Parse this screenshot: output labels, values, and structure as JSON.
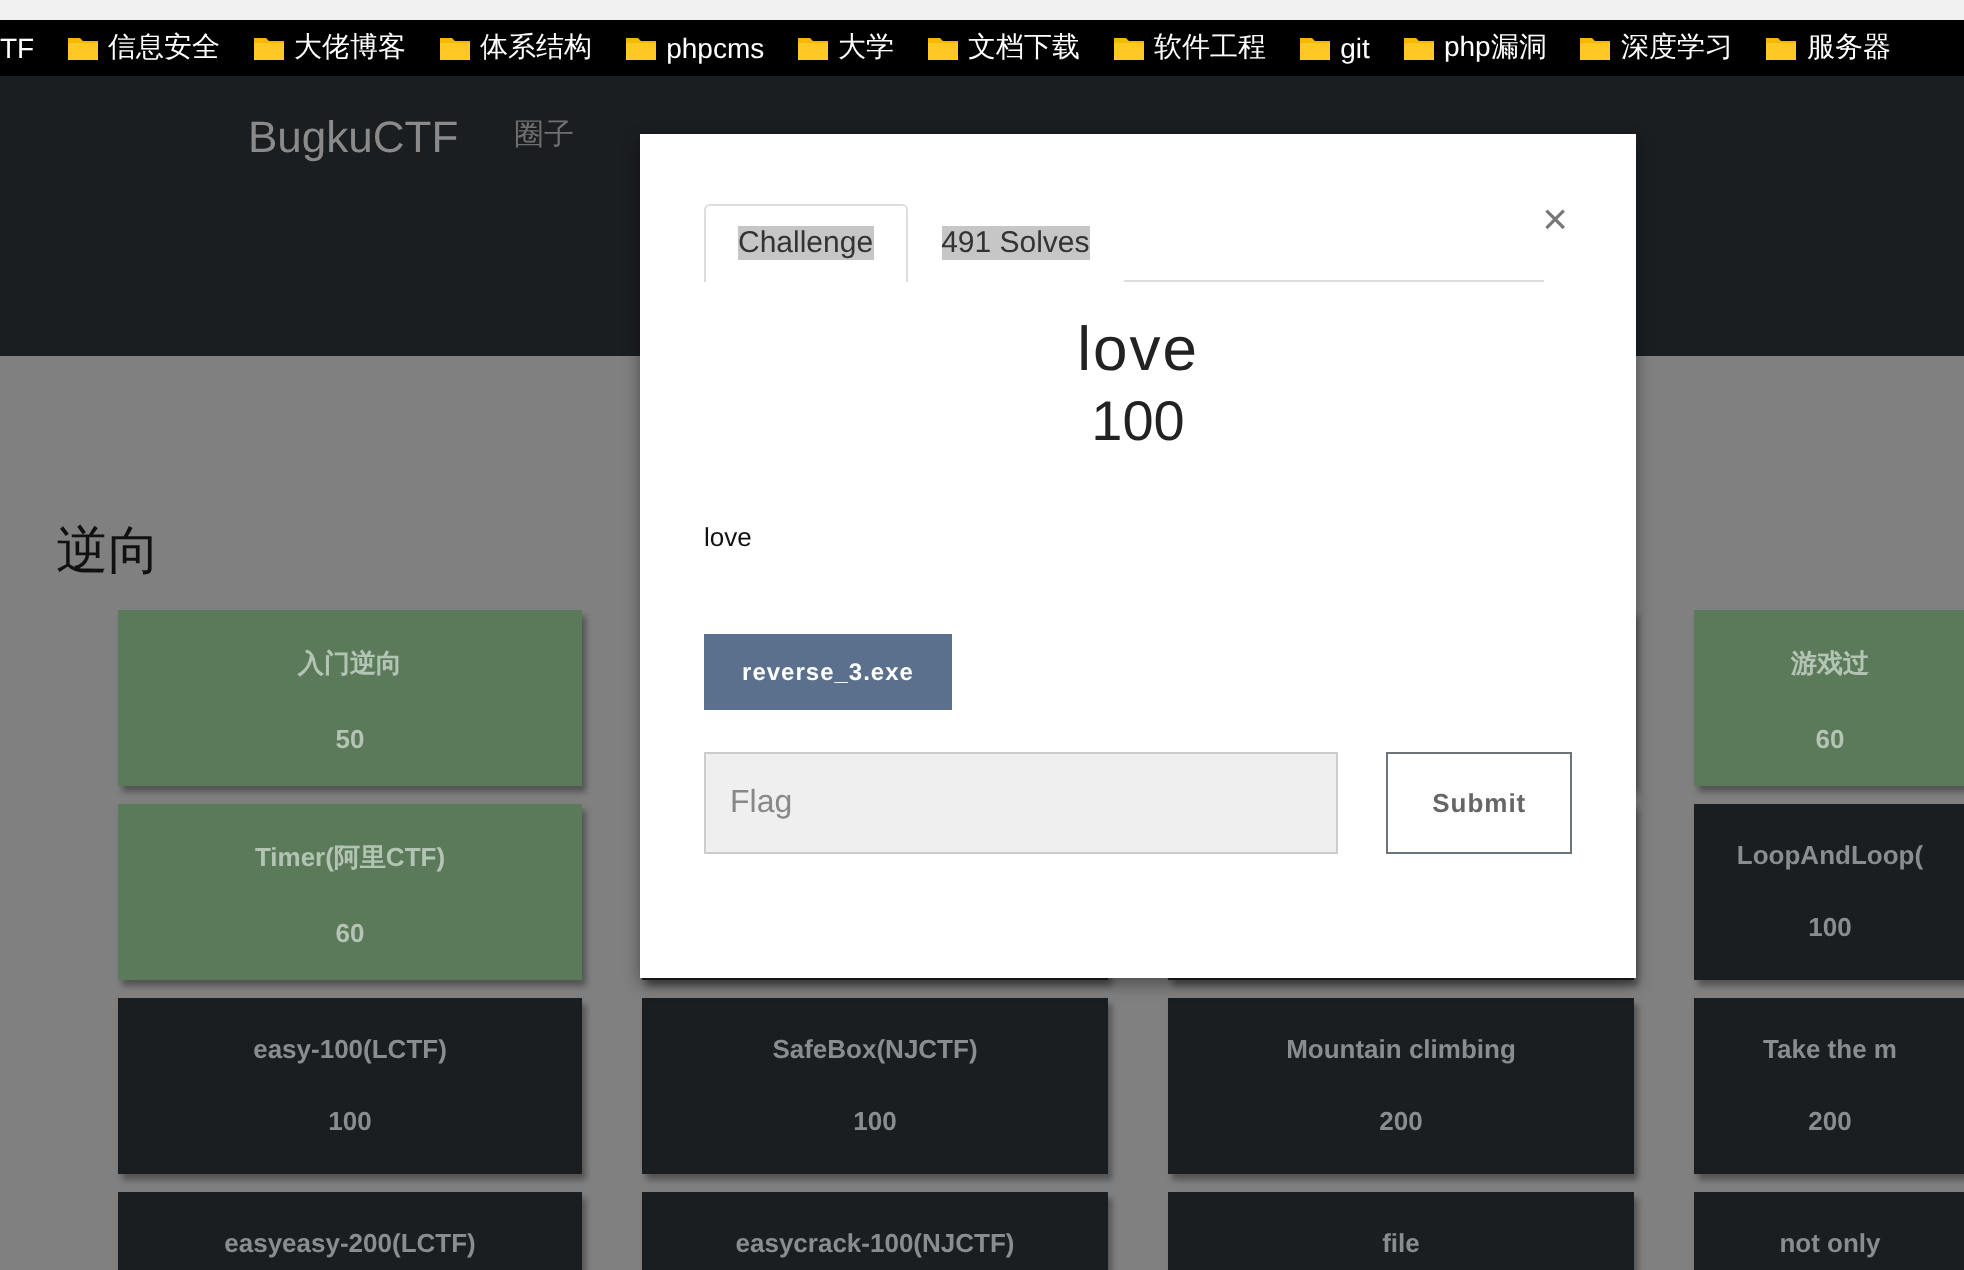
{
  "bookmarks": [
    {
      "label": "TF",
      "folder": false
    },
    {
      "label": "信息安全",
      "folder": true
    },
    {
      "label": "大佬博客",
      "folder": true
    },
    {
      "label": "体系结构",
      "folder": true
    },
    {
      "label": "phpcms",
      "folder": true
    },
    {
      "label": "大学",
      "folder": true
    },
    {
      "label": "文档下载",
      "folder": true
    },
    {
      "label": "软件工程",
      "folder": true
    },
    {
      "label": "git",
      "folder": true
    },
    {
      "label": "php漏洞",
      "folder": true
    },
    {
      "label": "深度学习",
      "folder": true
    },
    {
      "label": "服务器",
      "folder": true
    }
  ],
  "nav": {
    "brand": "BugkuCTF",
    "links": [
      "圈子"
    ]
  },
  "section_title": "逆向",
  "cards": [
    {
      "title": "入门逆向",
      "points": "50",
      "solved": true
    },
    {
      "title": "游戏过",
      "points": "60",
      "solved": true
    },
    {
      "title": "Timer(阿里CTF)",
      "points": "60",
      "solved": true
    },
    {
      "title": "LoopAndLoop(",
      "points": "100",
      "solved": false
    },
    {
      "title": "easy-100(LCTF)",
      "points": "100",
      "solved": false
    },
    {
      "title": "SafeBox(NJCTF)",
      "points": "100",
      "solved": false
    },
    {
      "title": "Mountain climbing",
      "points": "200",
      "solved": false
    },
    {
      "title": "Take the m",
      "points": "200",
      "solved": false
    },
    {
      "title": "easyeasy-200(LCTF)",
      "solved": false
    },
    {
      "title": "easycrack-100(NJCTF)",
      "solved": false
    },
    {
      "title": "file",
      "solved": false
    },
    {
      "title": "not only",
      "solved": false
    }
  ],
  "modal": {
    "tabs": [
      {
        "label": "Challenge",
        "selected": true
      },
      {
        "label": "491 Solves",
        "selected": false
      }
    ],
    "close": "×",
    "name": "love",
    "points": "100",
    "description": "love",
    "file": "reverse_3.exe",
    "flag": {
      "placeholder": "Flag"
    },
    "submit": "Submit"
  }
}
